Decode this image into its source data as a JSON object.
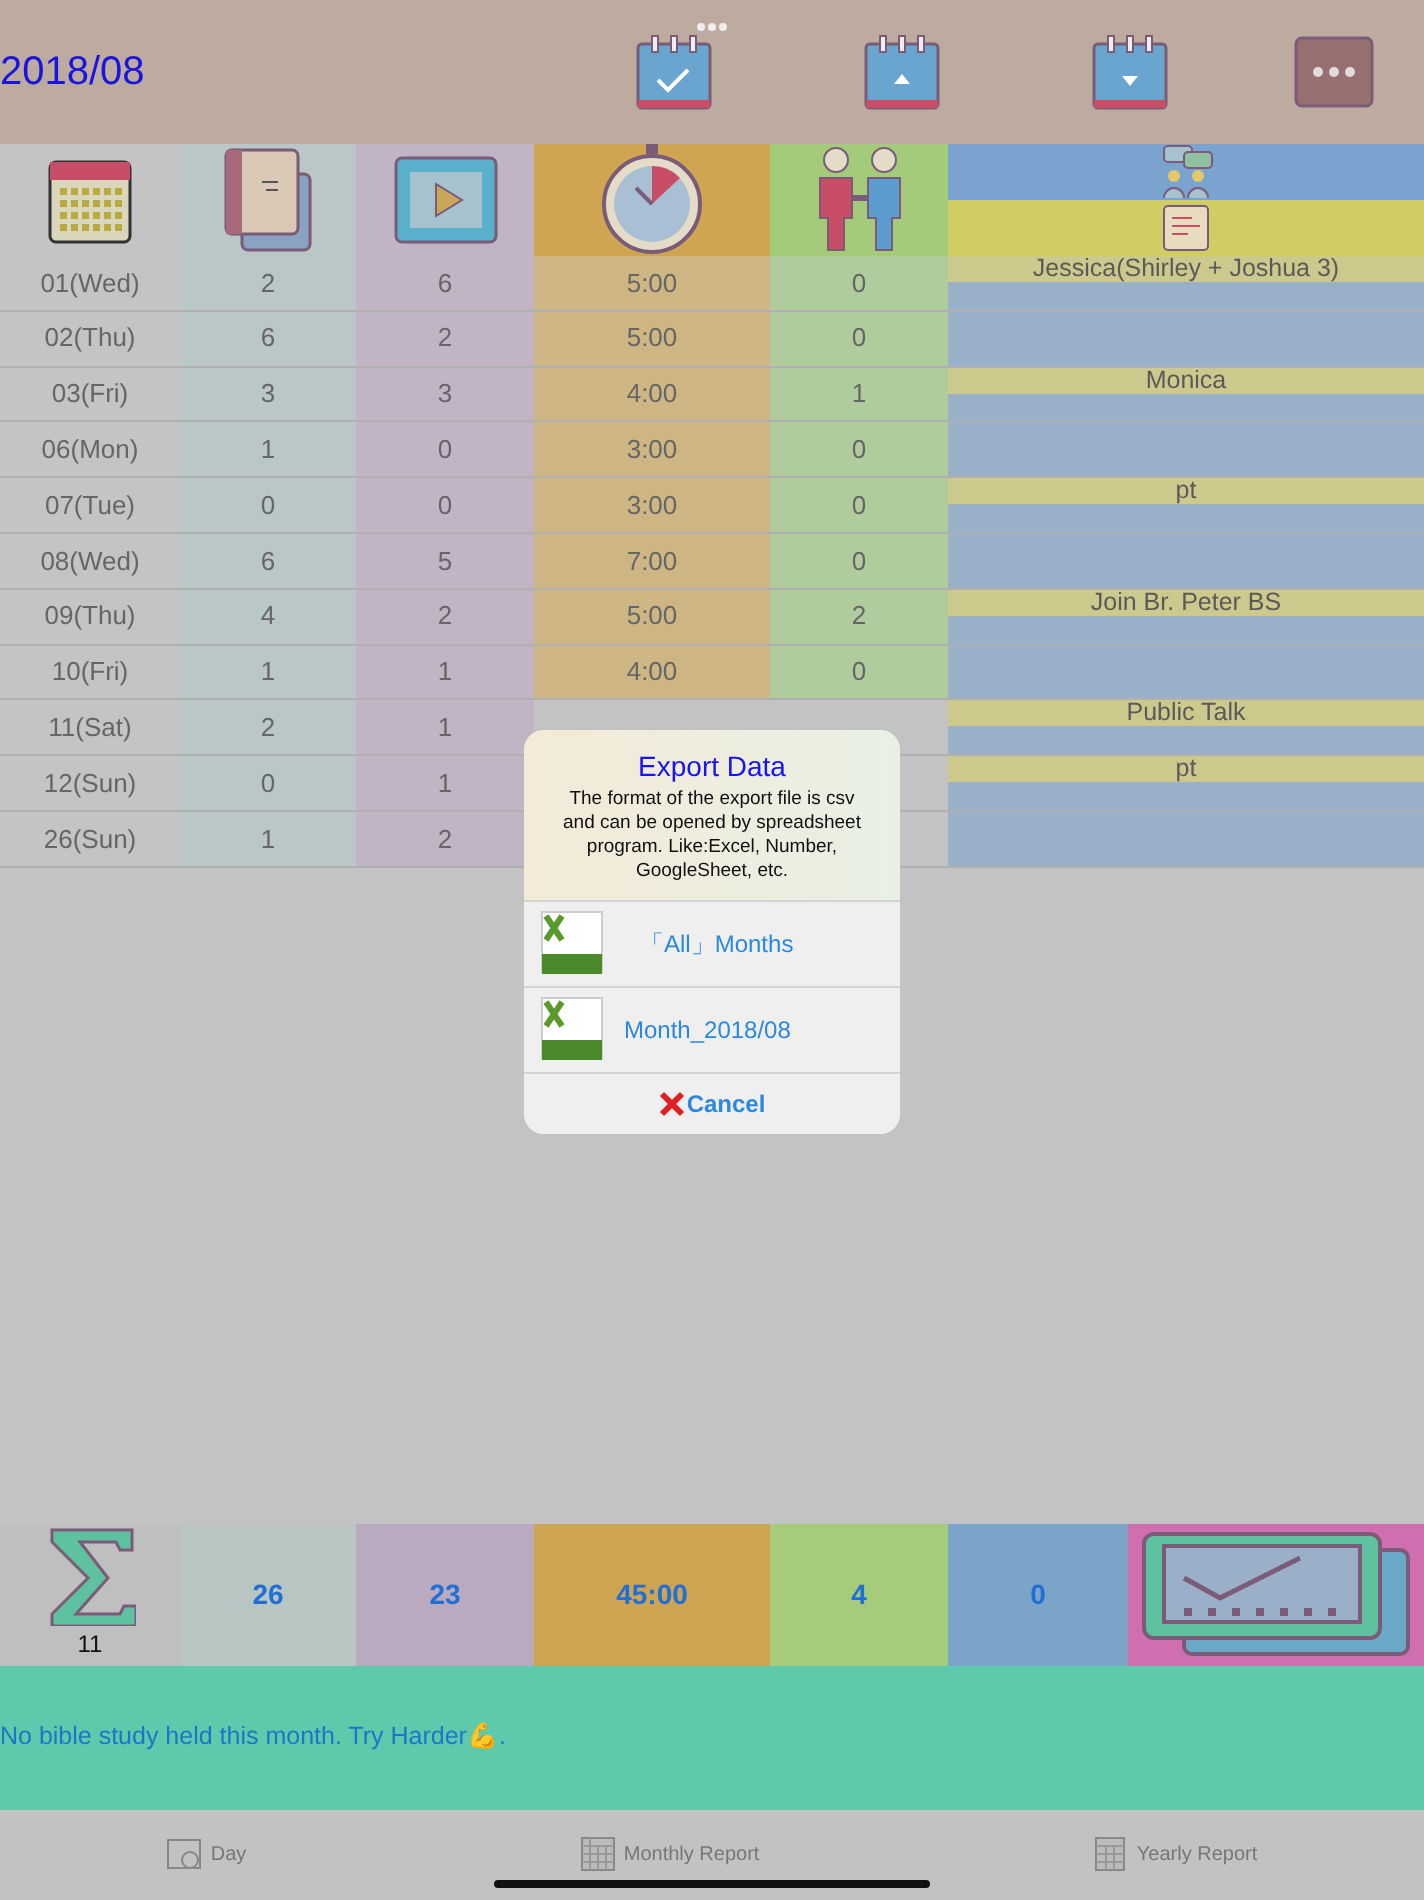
{
  "header": {
    "title": "2018/08"
  },
  "rows": [
    {
      "date": "01(Wed)",
      "col_2": "2",
      "col_3": "6",
      "hours": "5:00",
      "col_5": "0",
      "note": "Jessica(Shirley + Joshua 3)"
    },
    {
      "date": "02(Thu)",
      "col_2": "6",
      "col_3": "2",
      "hours": "5:00",
      "col_5": "0"
    },
    {
      "date": "03(Fri)",
      "col_2": "3",
      "col_3": "3",
      "hours": "4:00",
      "col_5": "1",
      "note": "Monica"
    },
    {
      "date": "06(Mon)",
      "col_2": "1",
      "col_3": "0",
      "hours": "3:00",
      "col_5": "0"
    },
    {
      "date": "07(Tue)",
      "col_2": "0",
      "col_3": "0",
      "hours": "3:00",
      "col_5": "0",
      "note": "pt"
    },
    {
      "date": "08(Wed)",
      "col_2": "6",
      "col_3": "5",
      "hours": "7:00",
      "col_5": "0"
    },
    {
      "date": "09(Thu)",
      "col_2": "4",
      "col_3": "2",
      "hours": "5:00",
      "col_5": "2",
      "note": "Join Br. Peter BS"
    },
    {
      "date": "10(Fri)",
      "col_2": "1",
      "col_3": "1",
      "hours": "4:00",
      "col_5": "0"
    },
    {
      "date": "11(Sat)",
      "col_2": "2",
      "col_3": "1",
      "note": "Public Talk"
    },
    {
      "date": "12(Sun)",
      "col_2": "0",
      "col_3": "1",
      "note": "pt"
    },
    {
      "date": "26(Sun)",
      "col_2": "1",
      "col_3": "2"
    }
  ],
  "totals": {
    "days": "11",
    "values": [
      "26",
      "23",
      "45:00",
      "4",
      "0"
    ]
  },
  "message": "No bible study held this month. Try Harder💪.",
  "dialog": {
    "title": "Export Data",
    "text": "The format of the export file is csv and can be opened by spreadsheet program. Like:Excel, Number, GoogleSheet, etc.",
    "options": [
      {
        "label": "「All」Months"
      },
      {
        "label": "Month_2018/08"
      }
    ],
    "cancel": "Cancel"
  },
  "tabs": [
    {
      "label": "Day",
      "kind": "day"
    },
    {
      "label": "Monthly Report",
      "kind": "month"
    },
    {
      "label": "Yearly Report",
      "kind": "year"
    }
  ]
}
